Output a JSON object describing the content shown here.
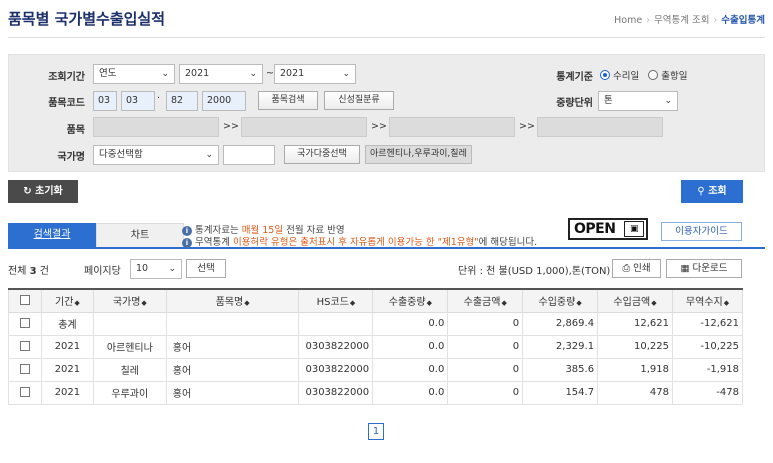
{
  "header": {
    "title": "품목별 국가별수출입실적",
    "breadcrumb": [
      "Home",
      "무역통계 조회",
      "수출입통계"
    ]
  },
  "search": {
    "period_label": "조회기간",
    "period_type": "연도",
    "period_from": "2021",
    "period_sep": "~",
    "period_to": "2021",
    "stat_basis_label": "통계기준",
    "stat_basis_options": [
      "수리일",
      "출항일"
    ],
    "item_code_label": "품목코드",
    "item_code": [
      "03",
      "03",
      "82",
      "2000"
    ],
    "item_code_dot": "·",
    "item_search_button": "품목검색",
    "new_classification_button": "신성질분류",
    "weight_unit_label": "중량단위",
    "weight_unit": "톤",
    "item_label": "품목",
    "arrow": ">>",
    "country_label": "국가명",
    "country_select": "다중선택함",
    "country_multi_button": "국가다중선택",
    "country_selected": "아르헨티나,우루과이,칠레"
  },
  "actions": {
    "reset_label": "초기화",
    "search_label": "조회"
  },
  "tabs": [
    "검색결과",
    "차트"
  ],
  "notice": {
    "line1_pre": "통계자료는 ",
    "line1_hl": "매월 15일",
    "line1_post": " 전월 자료 반영",
    "line2_pre": "무역통계 ",
    "line2_hl": "이용허락 유형은 출처표시 후 자유롭게 이용가능 한 \"제1유형\"",
    "line2_post": "에 해당됩니다."
  },
  "open_logo": "OPEN",
  "guide_button": "이용자가이드",
  "toolbar": {
    "total_pre": "전체 ",
    "total_count": "3",
    "total_post": " 건",
    "per_page_label": "페이지당",
    "per_page_value": "10",
    "select_button": "선택",
    "unit_text": "단위 : 천 불(USD 1,000),톤(TON)",
    "print_button": "인쇄",
    "download_button": "다운로드"
  },
  "table": {
    "columns": [
      "기간",
      "국가명",
      "품목명",
      "HS코드",
      "수출중량",
      "수출금액",
      "수입중량",
      "수입금액",
      "무역수지"
    ],
    "rows": [
      [
        "총계",
        "",
        "",
        "",
        "0.0",
        "0",
        "2,869.4",
        "12,621",
        "-12,621"
      ],
      [
        "2021",
        "아르헨티나",
        "홍어",
        "0303822000",
        "0.0",
        "0",
        "2,329.1",
        "10,225",
        "-10,225"
      ],
      [
        "2021",
        "칠레",
        "홍어",
        "0303822000",
        "0.0",
        "0",
        "385.6",
        "1,918",
        "-1,918"
      ],
      [
        "2021",
        "우루과이",
        "홍어",
        "0303822000",
        "0.0",
        "0",
        "154.7",
        "478",
        "-478"
      ]
    ]
  },
  "pagination": {
    "current": "1"
  }
}
